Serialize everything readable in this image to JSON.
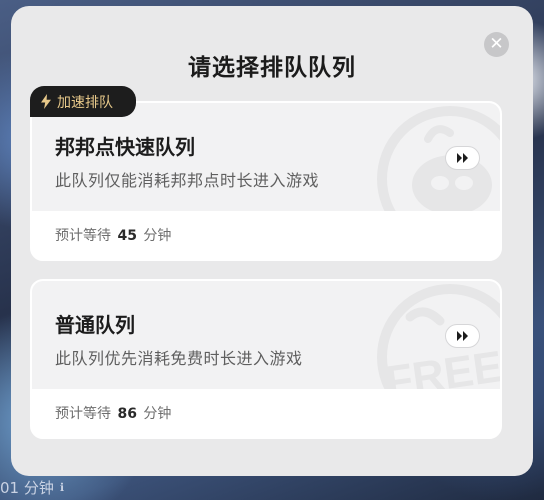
{
  "modal": {
    "title": "请选择排队队列",
    "close_label": "✕"
  },
  "queues": [
    {
      "badge": "加速排队",
      "name": "邦邦点快速队列",
      "description": "此队列仅能消耗邦邦点时长进入游戏",
      "wait_prefix": "预计等待",
      "wait_minutes": "45",
      "wait_unit": "分钟",
      "watermark_icon": "pig-logo-icon"
    },
    {
      "name": "普通队列",
      "description": "此队列优先消耗免费时长进入游戏",
      "wait_prefix": "预计等待",
      "wait_minutes": "86",
      "wait_unit": "分钟",
      "watermark_icon": "free-logo-icon",
      "watermark_text": "FREE"
    }
  ],
  "background": {
    "footer_text": "01 分钟",
    "footer_icon": "info-icon"
  },
  "colors": {
    "badge_bg": "#1d1d1d",
    "badge_text": "#e8c98a",
    "modal_bg": "#e9e9ea"
  },
  "icons": {
    "bolt": "lightning-bolt-icon",
    "go": "double-chevron-right-icon",
    "close": "close-icon"
  }
}
